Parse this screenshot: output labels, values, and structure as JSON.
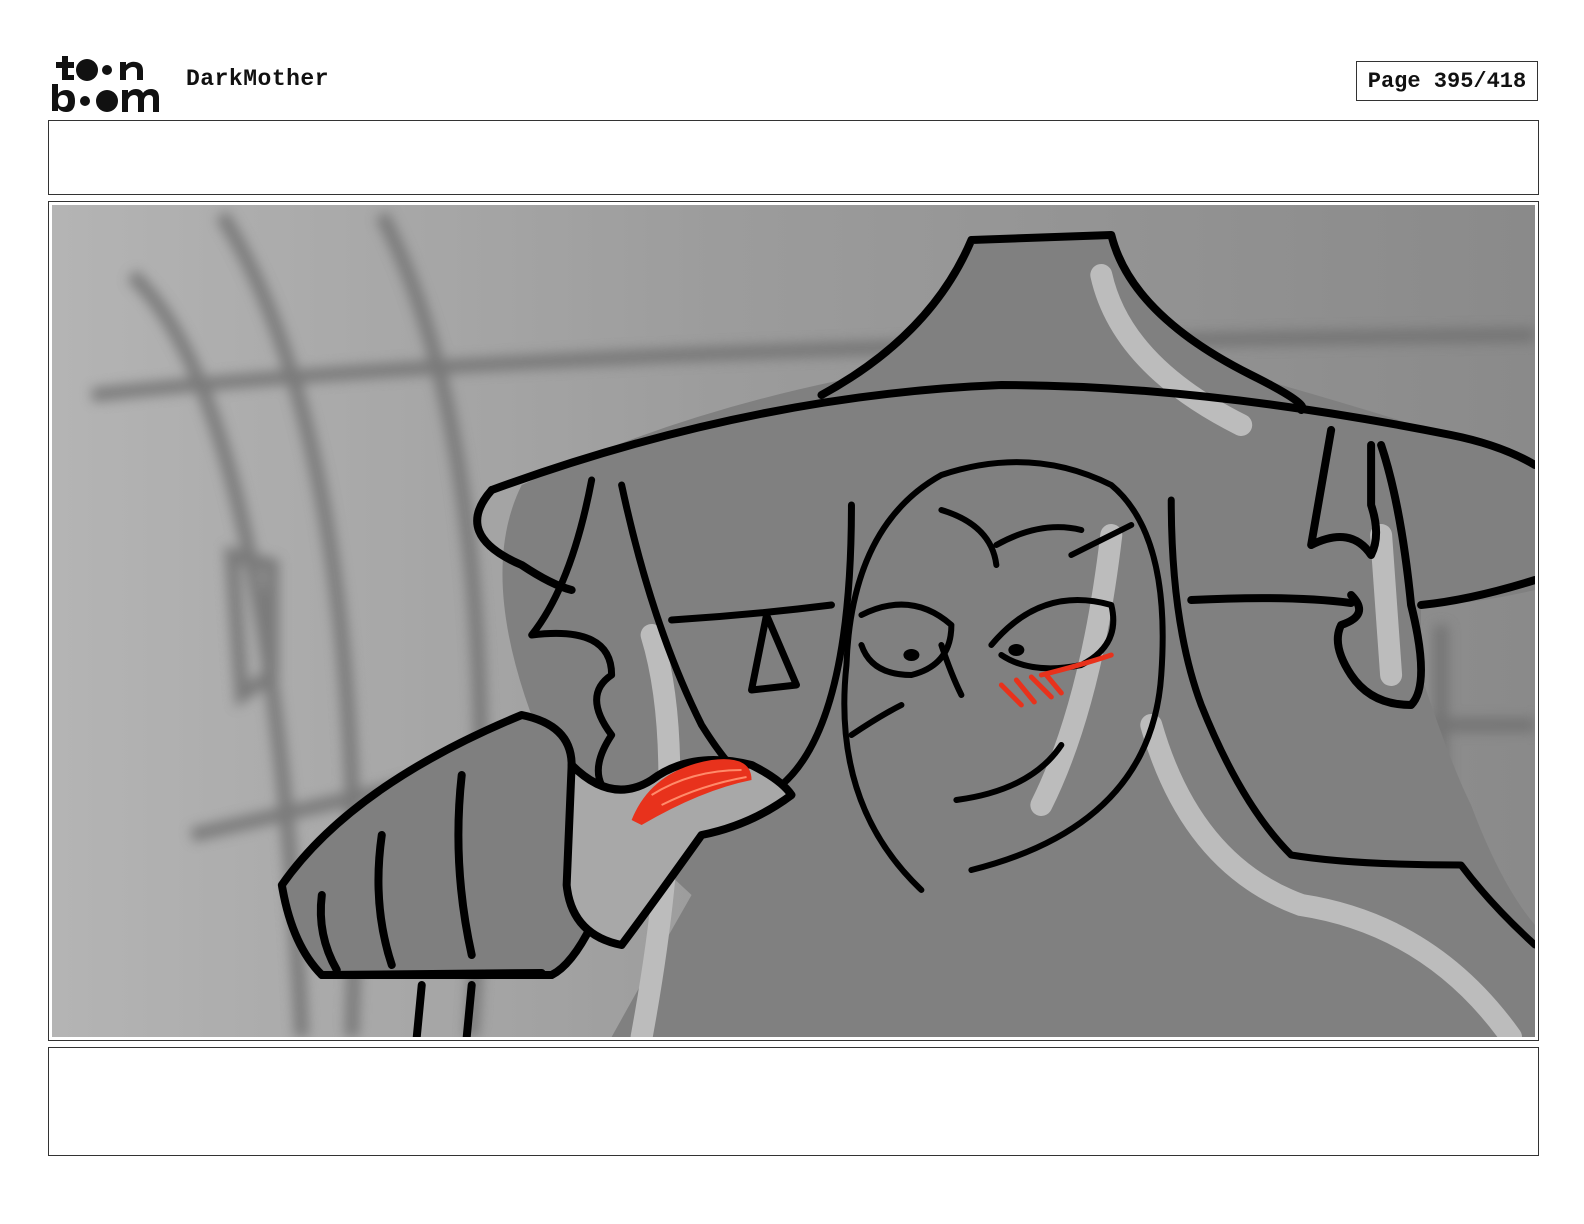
{
  "header": {
    "logo_text": "toon boom",
    "project_title": "DarkMother",
    "page_label": "Page 395/418"
  },
  "panel": {
    "description_text": "",
    "notes_text": ""
  },
  "colors": {
    "accent_red": "#e8321c",
    "panel_gray": "#7d7d7d",
    "highlight_gray": "#bdbdbd",
    "line_black": "#000000"
  }
}
